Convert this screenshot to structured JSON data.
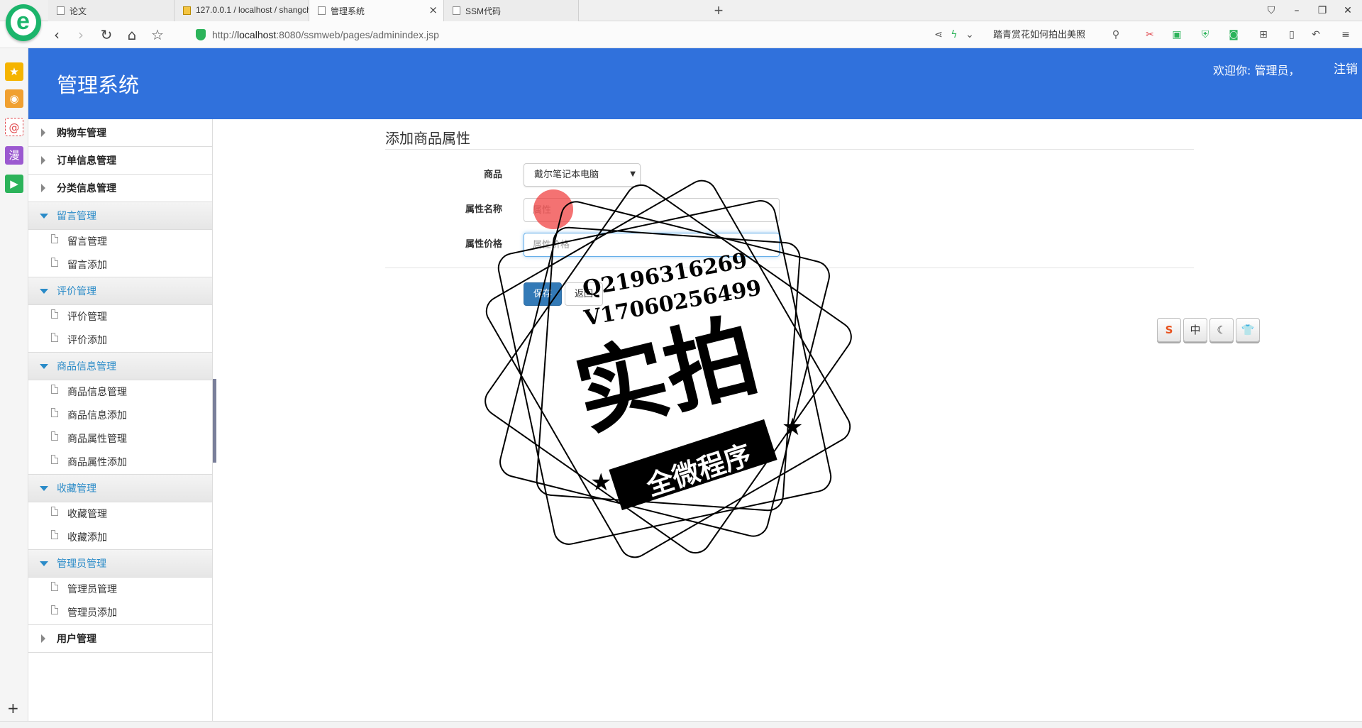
{
  "browser": {
    "tabs": [
      {
        "label": "论文",
        "active": false
      },
      {
        "label": "127.0.0.1 / localhost / shangch",
        "active": false
      },
      {
        "label": "管理系统",
        "active": true
      },
      {
        "label": "SSM代码",
        "active": false
      }
    ],
    "new_tab": "+",
    "url_prefix": "http://",
    "url_host": "localhost",
    "url_rest": ":8080/ssmweb/pages/adminindex.jsp",
    "search_text": "踏青赏花如何拍出美照"
  },
  "header": {
    "title": "管理系统",
    "welcome": "欢迎你: 管理员，",
    "logout": "注销",
    "color": "#3071dc"
  },
  "sidebar": {
    "groups": [
      {
        "label": "购物车管理",
        "expanded": false,
        "items": []
      },
      {
        "label": "订单信息管理",
        "expanded": false,
        "items": []
      },
      {
        "label": "分类信息管理",
        "expanded": false,
        "items": []
      },
      {
        "label": "留言管理",
        "expanded": true,
        "items": [
          "留言管理",
          "留言添加"
        ]
      },
      {
        "label": "评价管理",
        "expanded": true,
        "items": [
          "评价管理",
          "评价添加"
        ]
      },
      {
        "label": "商品信息管理",
        "expanded": true,
        "items": [
          "商品信息管理",
          "商品信息添加",
          "商品属性管理",
          "商品属性添加"
        ]
      },
      {
        "label": "收藏管理",
        "expanded": true,
        "items": [
          "收藏管理",
          "收藏添加"
        ]
      },
      {
        "label": "管理员管理",
        "expanded": true,
        "items": [
          "管理员管理",
          "管理员添加"
        ]
      },
      {
        "label": "用户管理",
        "expanded": false,
        "items": []
      }
    ]
  },
  "form": {
    "title": "添加商品属性",
    "product_label": "商品",
    "product_value": "戴尔笔记本电脑",
    "attr_name_label": "属性名称",
    "attr_name_placeholder": "属性",
    "attr_price_label": "属性价格",
    "attr_price_placeholder": "属性价格",
    "save_label": "保存",
    "back_label": "返回"
  },
  "ime": {
    "keys": [
      "S",
      "中",
      "☾",
      "👕"
    ]
  },
  "watermark": {
    "qq": "Q2196316269",
    "wechat": "V17060256499",
    "big_text": "实拍",
    "banner_text": "全微程序"
  }
}
